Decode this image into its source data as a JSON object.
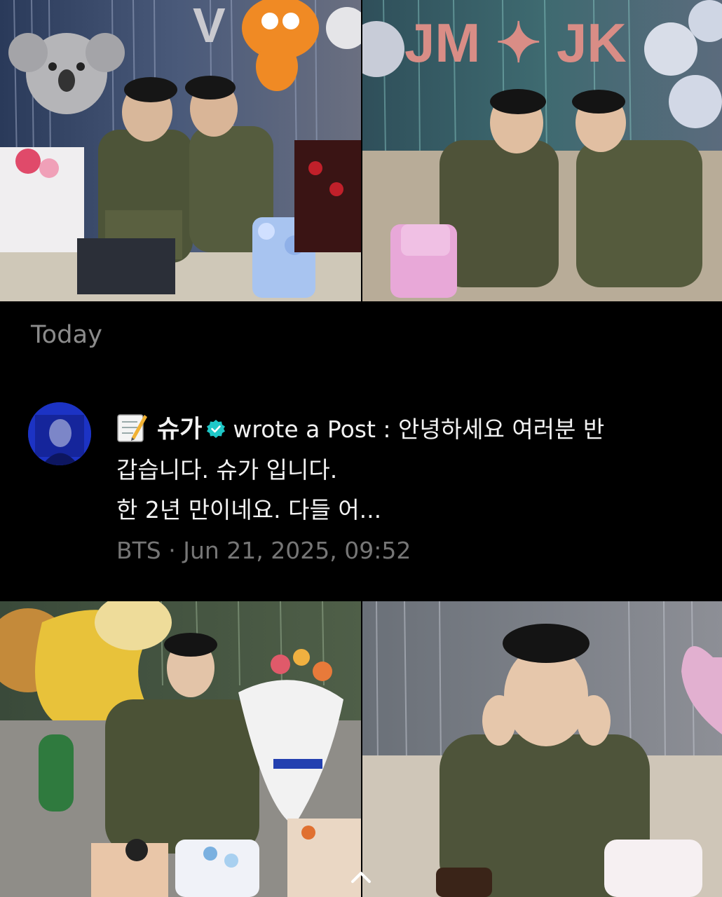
{
  "notifications": {
    "section_label": "Today",
    "item": {
      "author": "슈가",
      "action": "wrote a Post :",
      "preview_line1": "안녕하세요 여러분 반",
      "preview_line2": "갑습니다. 슈가 입니다.",
      "preview_line3": "한 2년 만이네요. 다들 어...",
      "artist": "BTS",
      "separator": "·",
      "timestamp": "Jun 21, 2025, 09:52"
    }
  },
  "photos": {
    "top_left_balloons": "V",
    "top_right_balloons": "JM ✦ JK"
  },
  "icons": {
    "memo": "memo-icon",
    "verified": "verified-badge-icon",
    "scroll": "chevron-up-icon"
  },
  "colors": {
    "background": "#000000",
    "verified": "#1ec8c8",
    "muted_text": "#8b8b8b"
  }
}
